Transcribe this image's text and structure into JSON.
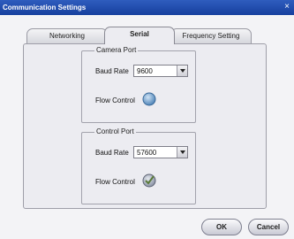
{
  "window": {
    "title": "Communication Settings",
    "close_glyph": "×"
  },
  "tabs": [
    {
      "label": "Networking"
    },
    {
      "label": "Serial"
    },
    {
      "label": "Frequency Setting"
    }
  ],
  "camera_port": {
    "legend": "Camera Port",
    "baud_label": "Baud Rate",
    "baud_value": "9600",
    "flow_label": "Flow Control",
    "flow_checked": false
  },
  "control_port": {
    "legend": "Control Port",
    "baud_label": "Baud Rate",
    "baud_value": "57600",
    "flow_label": "Flow Control",
    "flow_checked": true
  },
  "buttons": {
    "ok": "OK",
    "cancel": "Cancel"
  },
  "colors": {
    "titlebar": "#1f4aaa",
    "toggle_blue": "#4f84b8",
    "check_green": "#5a7a3a"
  }
}
